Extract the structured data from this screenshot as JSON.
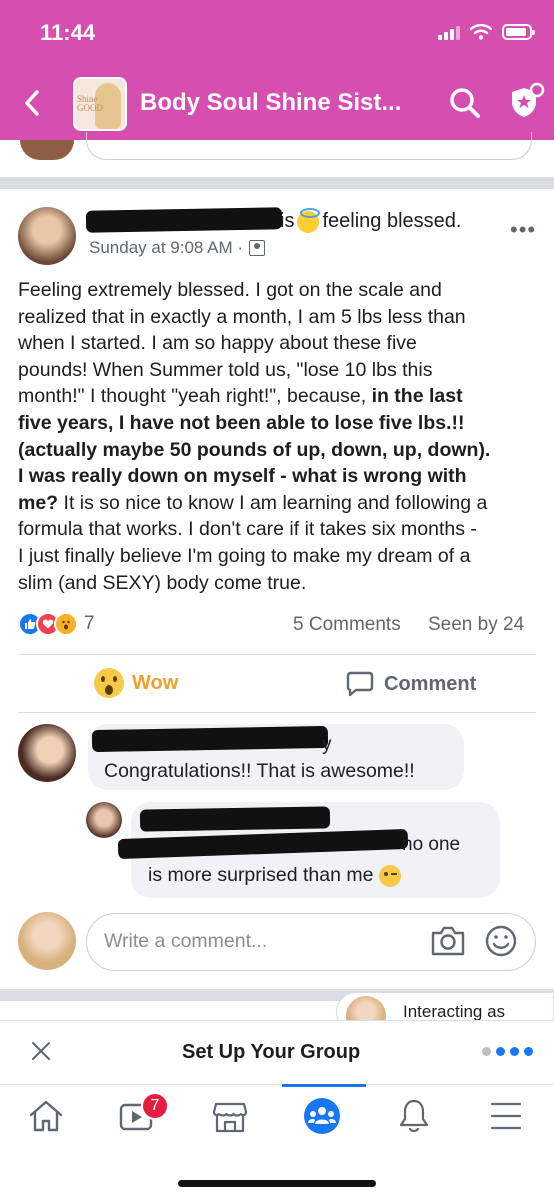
{
  "status_bar": {
    "time": "11:44"
  },
  "header": {
    "title": "Body Soul Shine Sist...",
    "thumb_text": "Shine\nGOOD"
  },
  "post": {
    "feeling_prefix": "is",
    "feeling_text": "feeling blessed.",
    "timestamp": "Sunday at 9:08 AM ·",
    "more": "•••",
    "body_lines": [
      [
        "Feeling extremely blessed. I got on the scale and",
        ""
      ],
      [
        "realized that in exactly a month, I am 5 lbs less than",
        ""
      ],
      [
        "when I started. I am so happy about these five",
        ""
      ],
      [
        "pounds! When Summer told us, \"lose 10 lbs this",
        ""
      ],
      [
        "month!\" I thought \"yeah right!\", because, ",
        "in the last"
      ],
      [
        "",
        "five years, I have not been able to lose five lbs.!!"
      ],
      [
        "",
        "(actually maybe 50 pounds of up, down, up, down)."
      ],
      [
        "",
        "I was really down on myself - what is wrong with"
      ],
      [
        "",
        "me?",
        " It is so nice to know I am learning and following a"
      ],
      [
        "formula that works. I don't care if it takes six months -",
        ""
      ],
      [
        "I just finally believe I'm going to make my dream of a",
        ""
      ],
      [
        "slim (and SEXY) body come true.",
        ""
      ]
    ],
    "reaction_count": "7",
    "comments_count": "5 Comments",
    "seen_by": "Seen by 24",
    "wow_label": "Wow",
    "comment_label": "Comment"
  },
  "comments": [
    {
      "name_visible": "y",
      "text": "Congratulations!! That is awesome!!"
    },
    {
      "name_visible": "no one",
      "text": "is more surprised than me"
    }
  ],
  "composer": {
    "placeholder": "Write a comment..."
  },
  "interacting_as": "Interacting as",
  "setup_banner": {
    "title": "Set Up Your Group"
  },
  "tabbar": {
    "video_badge": "7"
  },
  "colors": {
    "header": "#d64fb0",
    "accent": "#1877f2",
    "badge": "#e41e3f"
  }
}
